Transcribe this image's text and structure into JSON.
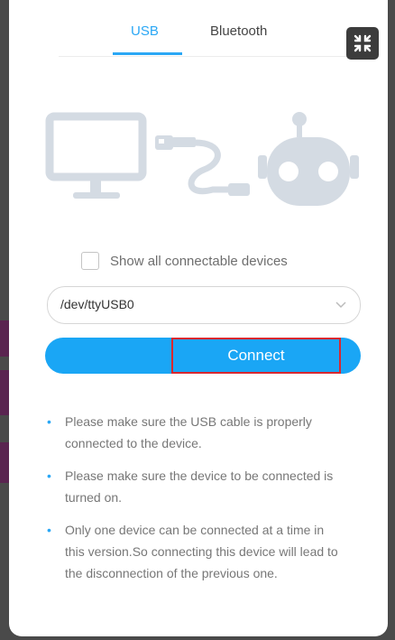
{
  "tabs": [
    {
      "label": "USB",
      "active": true
    },
    {
      "label": "Bluetooth",
      "active": false
    }
  ],
  "icons": {
    "expand": "fullscreen-exit-icon",
    "illustration": [
      "monitor-icon",
      "usb-cable-icon",
      "robot-icon"
    ],
    "dropdown": "chevron-down-icon"
  },
  "show_all_label": "Show all connectable devices",
  "show_all_checked": false,
  "port_select": {
    "selected": "/dev/ttyUSB0"
  },
  "connect_label": "Connect",
  "tips": [
    "Please make sure the USB cable is properly connected to the device.",
    "Please make sure the device to be connected is turned on.",
    "Only one device can be connected at a time in this version.So connecting this device will lead to the disconnection of the previous one."
  ],
  "colors": {
    "accent": "#1aa6f5",
    "highlight_border": "#d9282f",
    "illustration": "#d4dbe3",
    "panel_bg": "#ffffff"
  }
}
